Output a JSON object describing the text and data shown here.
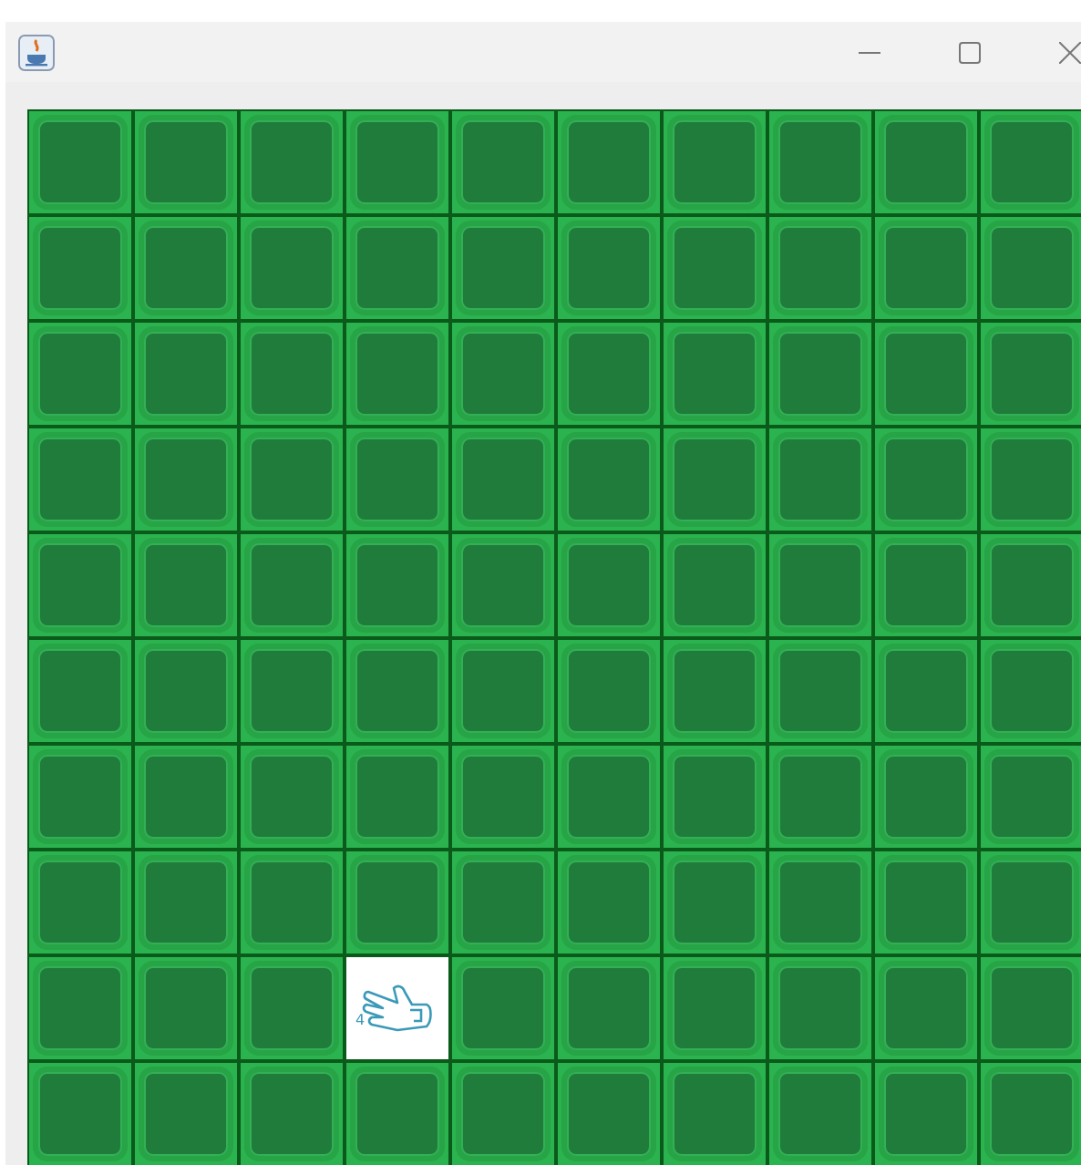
{
  "board": {
    "rows": [
      [
        {
          "revealed": false
        },
        {
          "revealed": false
        },
        {
          "revealed": false
        },
        {
          "revealed": false
        },
        {
          "revealed": false
        },
        {
          "revealed": false
        },
        {
          "revealed": false
        },
        {
          "revealed": false
        },
        {
          "revealed": false
        },
        {
          "revealed": false
        }
      ],
      [
        {
          "revealed": false
        },
        {
          "revealed": false
        },
        {
          "revealed": false
        },
        {
          "revealed": false
        },
        {
          "revealed": false
        },
        {
          "revealed": false
        },
        {
          "revealed": false
        },
        {
          "revealed": false
        },
        {
          "revealed": false
        },
        {
          "revealed": false
        }
      ],
      [
        {
          "revealed": false
        },
        {
          "revealed": false
        },
        {
          "revealed": false
        },
        {
          "revealed": false
        },
        {
          "revealed": false
        },
        {
          "revealed": false
        },
        {
          "revealed": false
        },
        {
          "revealed": false
        },
        {
          "revealed": false
        },
        {
          "revealed": false
        }
      ],
      [
        {
          "revealed": false
        },
        {
          "revealed": false
        },
        {
          "revealed": false
        },
        {
          "revealed": false
        },
        {
          "revealed": false
        },
        {
          "revealed": false
        },
        {
          "revealed": false
        },
        {
          "revealed": false
        },
        {
          "revealed": false
        },
        {
          "revealed": false
        }
      ],
      [
        {
          "revealed": false
        },
        {
          "revealed": false
        },
        {
          "revealed": false
        },
        {
          "revealed": false
        },
        {
          "revealed": false
        },
        {
          "revealed": false
        },
        {
          "revealed": false
        },
        {
          "revealed": false
        },
        {
          "revealed": false
        },
        {
          "revealed": false
        }
      ],
      [
        {
          "revealed": false
        },
        {
          "revealed": false
        },
        {
          "revealed": false
        },
        {
          "revealed": false
        },
        {
          "revealed": false
        },
        {
          "revealed": false
        },
        {
          "revealed": false
        },
        {
          "revealed": false
        },
        {
          "revealed": false
        },
        {
          "revealed": false
        }
      ],
      [
        {
          "revealed": false
        },
        {
          "revealed": false
        },
        {
          "revealed": false
        },
        {
          "revealed": false
        },
        {
          "revealed": false
        },
        {
          "revealed": false
        },
        {
          "revealed": false
        },
        {
          "revealed": false
        },
        {
          "revealed": false
        },
        {
          "revealed": false
        }
      ],
      [
        {
          "revealed": false
        },
        {
          "revealed": false
        },
        {
          "revealed": false
        },
        {
          "revealed": false
        },
        {
          "revealed": false
        },
        {
          "revealed": false
        },
        {
          "revealed": false
        },
        {
          "revealed": false
        },
        {
          "revealed": false
        },
        {
          "revealed": false
        }
      ],
      [
        {
          "revealed": false
        },
        {
          "revealed": false
        },
        {
          "revealed": false
        },
        {
          "revealed": true,
          "number": "4"
        },
        {
          "revealed": false
        },
        {
          "revealed": false
        },
        {
          "revealed": false
        },
        {
          "revealed": false
        },
        {
          "revealed": false
        },
        {
          "revealed": false
        }
      ],
      [
        {
          "revealed": false
        },
        {
          "revealed": false
        },
        {
          "revealed": false
        },
        {
          "revealed": false
        },
        {
          "revealed": false
        },
        {
          "revealed": false
        },
        {
          "revealed": false
        },
        {
          "revealed": false
        },
        {
          "revealed": false
        },
        {
          "revealed": false
        }
      ]
    ]
  }
}
